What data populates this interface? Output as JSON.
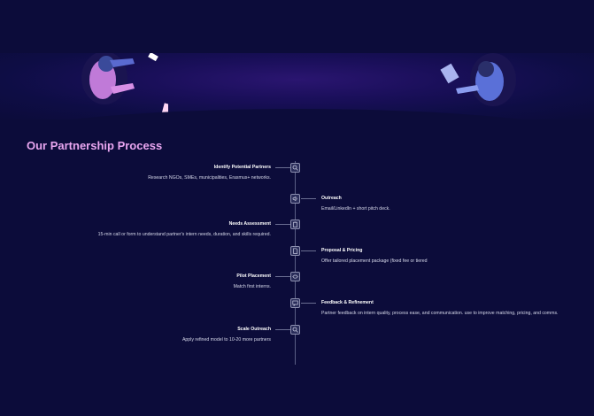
{
  "section": {
    "title": "Our Partnership Process"
  },
  "steps": [
    {
      "title": "Identify Potential Partners",
      "desc": "Research NGOs, SMEs, municipalities, Erasmus+ networks.",
      "side": "left",
      "icon": "search-icon"
    },
    {
      "title": "Outreach",
      "desc": "Email/LinkedIn + short pitch deck.",
      "side": "right",
      "icon": "megaphone-icon"
    },
    {
      "title": "Needs Assessment",
      "desc": "15-min call or form to understand partner's intern needs, duration, and skills required.",
      "side": "left",
      "icon": "clipboard-icon"
    },
    {
      "title": "Proposal & Pricing",
      "desc": "Offer tailored placement package (fixed fee or tiered",
      "side": "right",
      "icon": "document-icon"
    },
    {
      "title": "Pilot Placement",
      "desc": "Match first interns.",
      "side": "left",
      "icon": "handshake-icon"
    },
    {
      "title": "Feedback & Refinement",
      "desc": "Partner feedback on intern quality, process ease, and communication. use to improve matching, pricing, and comms.",
      "side": "right",
      "icon": "feedback-icon"
    },
    {
      "title": "Scale Outreach",
      "desc": "Apply refined model to 10-20 more partners",
      "side": "left",
      "icon": "search-icon"
    }
  ]
}
